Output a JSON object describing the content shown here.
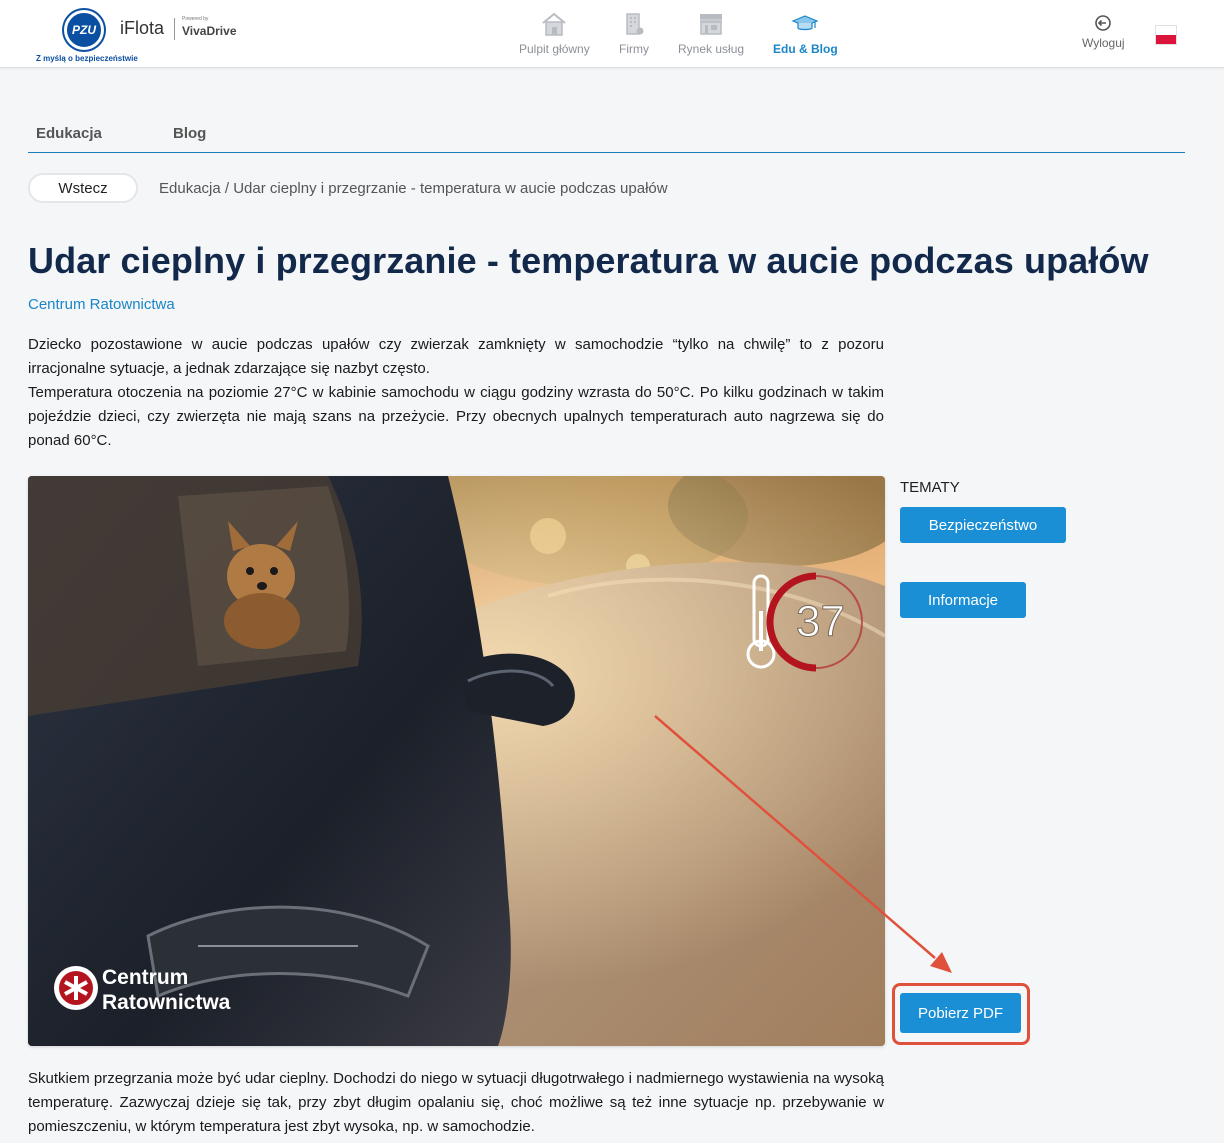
{
  "header": {
    "tagline": "Z myślą o bezpieczeństwie",
    "app_name": "iFlota",
    "powered_by": "Powered by",
    "partner": "VivaDrive",
    "nav": [
      {
        "label": "Pulpit główny",
        "icon": "home-icon"
      },
      {
        "label": "Firmy",
        "icon": "building-icon"
      },
      {
        "label": "Rynek usług",
        "icon": "store-icon"
      },
      {
        "label": "Edu & Blog",
        "icon": "graduation-cap-icon"
      }
    ],
    "logout": "Wyloguj",
    "language_flag": "polish-flag-icon"
  },
  "tabs": [
    "Edukacja",
    "Blog"
  ],
  "back_label": "Wstecz",
  "breadcrumb": "Edukacja / Udar cieplny i przegrzanie - temperatura w aucie podczas upałów",
  "article": {
    "title": "Udar cieplny i przegrzanie - temperatura w aucie podczas upałów",
    "source": "Centrum Ratownictwa",
    "intro_p1": "Dziecko pozostawione w aucie podczas upałów czy zwierzak zamknięty w samochodzie “tylko na chwilę” to z pozoru irracjonalne sytuacje, a jednak zdarzające się nazbyt często.",
    "intro_p2": "Temperatura otoczenia na poziomie 27°C w kabinie samochodu w ciągu godziny wzrasta do 50°C. Po kilku godzinach w takim pojeździe dzieci, czy zwierzęta nie mają szans na przeżycie. Przy obecnych upalnych temperaturach auto nagrzewa się do ponad 60°C.",
    "image_badge_number": "37",
    "image_watermark_line1": "Centrum",
    "image_watermark_line2": "Ratownictwa",
    "outro": "Skutkiem przegrzania może być udar cieplny. Dochodzi do niego w sytuacji długotrwałego i nadmiernego wystawienia na wysoką temperaturę. Zazwyczaj dzieje się tak, przy zbyt długim opalaniu się, choć możliwe są też inne sytuacje np. przebywanie w pomieszczeniu, w którym temperatura jest zbyt wysoka, np. w samochodzie."
  },
  "sidebar": {
    "topics_label": "TEMATY",
    "topics": [
      "Bezpieczeństwo",
      "Informacje"
    ],
    "pdf_button": "Pobierz PDF"
  },
  "colors": {
    "accent": "#1a8fd6",
    "title": "#13294b",
    "highlight": "#e0513c",
    "pzu_blue": "#0b4fa2"
  }
}
